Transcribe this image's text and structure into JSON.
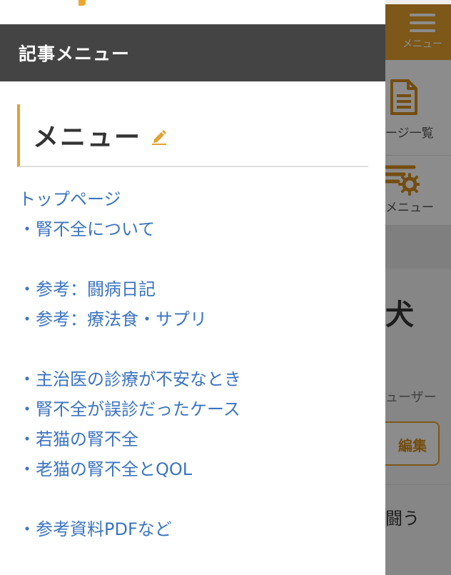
{
  "background": {
    "sidebar": {
      "menu_button_label": "メニュー",
      "page_list_label": "ージ一覧",
      "admin_menu_label": "メニュー"
    },
    "article": {
      "title_fragment": "犬",
      "user_fragment": "ューザー",
      "edit_button_label": "編集",
      "text_fragment": "闘う"
    }
  },
  "drawer": {
    "header_title": "記事メニュー",
    "widget_title": "メニュー",
    "menu_items": [
      "トップページ",
      "・腎不全について",
      "",
      "・参考：闘病日記",
      "・参考：療法食・サプリ",
      "",
      "・主治医の診療が不安なとき",
      "・腎不全が誤診だったケース",
      "・若猫の腎不全",
      "・老猫の腎不全とQOL",
      "",
      "・参考資料PDFなど"
    ]
  },
  "colors": {
    "accent": "#e4a12f",
    "header_bg": "#444444",
    "link": "#3b74c1",
    "heading_text": "#333333"
  },
  "icons": [
    "hamburger-icon",
    "document-icon",
    "settings-list-icon",
    "pencil-icon"
  ]
}
